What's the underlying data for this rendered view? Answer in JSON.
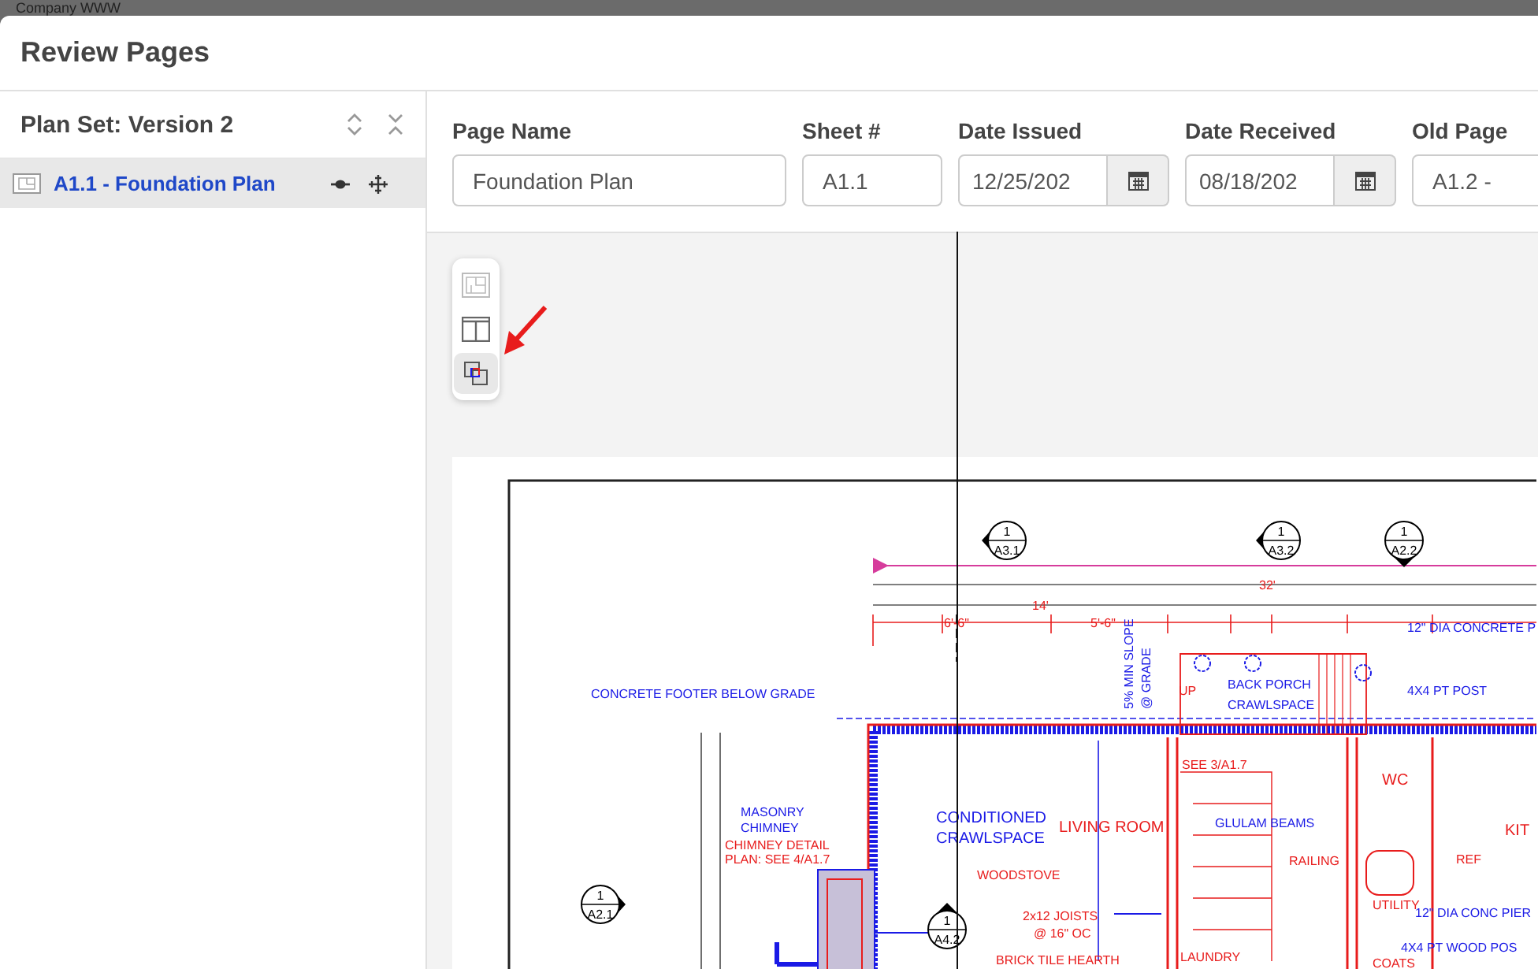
{
  "backdrop": {
    "title": "Company WWW"
  },
  "dialog": {
    "title": "Review Pages"
  },
  "sidebar": {
    "heading": "Plan Set: Version 2",
    "items": [
      {
        "label": "A1.1 - Foundation Plan",
        "selected": true
      }
    ]
  },
  "form": {
    "fields": [
      {
        "label": "Page Name",
        "value": "Foundation Plan",
        "kind": "text"
      },
      {
        "label": "Sheet #",
        "value": "A1.1",
        "kind": "text"
      },
      {
        "label": "Date Issued",
        "value": "12/25/202",
        "kind": "date"
      },
      {
        "label": "Date Received",
        "value": "08/18/202",
        "kind": "date"
      },
      {
        "label": "Old Page",
        "value": "A1.2 -",
        "kind": "select"
      }
    ]
  },
  "viewer": {
    "tools": [
      {
        "kind": "plan",
        "selected": false,
        "disabled": true
      },
      {
        "kind": "split",
        "selected": false,
        "disabled": false
      },
      {
        "kind": "overlay",
        "selected": true,
        "disabled": false
      }
    ],
    "drawing": {
      "labels": [
        {
          "text": "CONCRETE FOOTER BELOW GRADE",
          "kind": "note"
        },
        {
          "text": "5% MIN SLOPE",
          "kind": "note"
        },
        {
          "text": "@ GRADE",
          "kind": "note"
        },
        {
          "text": "BACK PORCH",
          "kind": "note"
        },
        {
          "text": "CRAWLSPACE",
          "kind": "note"
        },
        {
          "text": "12\" DIA CONCRETE P",
          "kind": "note"
        },
        {
          "text": "4X4 PT POST",
          "kind": "note"
        },
        {
          "text": "MASONRY",
          "kind": "note"
        },
        {
          "text": "CHIMNEY",
          "kind": "note"
        },
        {
          "text": "CHIMNEY DETAIL",
          "kind": "room"
        },
        {
          "text": "PLAN: SEE 4/A1.7",
          "kind": "room"
        },
        {
          "text": "CONDITIONED",
          "kind": "note"
        },
        {
          "text": "CRAWLSPACE",
          "kind": "note"
        },
        {
          "text": "LIVING ROOM",
          "kind": "room"
        },
        {
          "text": "WOODSTOVE",
          "kind": "room"
        },
        {
          "text": "2x12 JOISTS",
          "kind": "room"
        },
        {
          "text": "@ 16\" OC",
          "kind": "room"
        },
        {
          "text": "BRICK TILE HEARTH",
          "kind": "room"
        },
        {
          "text": "GLULAM BEAMS",
          "kind": "note"
        },
        {
          "text": "RAILING",
          "kind": "room"
        },
        {
          "text": "WC",
          "kind": "room"
        },
        {
          "text": "REF",
          "kind": "room"
        },
        {
          "text": "UTILITY",
          "kind": "room"
        },
        {
          "text": "12\" DIA CONC PIER",
          "kind": "note"
        },
        {
          "text": "4X4 PT WOOD POS",
          "kind": "note"
        },
        {
          "text": "COATS",
          "kind": "room"
        },
        {
          "text": "LAUNDRY",
          "kind": "room"
        },
        {
          "text": "KIT",
          "kind": "room"
        },
        {
          "text": "32'",
          "kind": "dim"
        },
        {
          "text": "14'",
          "kind": "dim"
        },
        {
          "text": "6'-6\"",
          "kind": "dim"
        },
        {
          "text": "5'-6\"",
          "kind": "dim"
        },
        {
          "text": "UP",
          "kind": "room"
        },
        {
          "text": "SEE 3/A1.7",
          "kind": "room"
        }
      ],
      "markers": [
        {
          "number": "1",
          "sheet": "A3.1"
        },
        {
          "number": "1",
          "sheet": "A3.2"
        },
        {
          "number": "1",
          "sheet": "A2.2"
        },
        {
          "number": "1",
          "sheet": "A2.1"
        },
        {
          "number": "1",
          "sheet": "A4.2"
        }
      ]
    }
  }
}
